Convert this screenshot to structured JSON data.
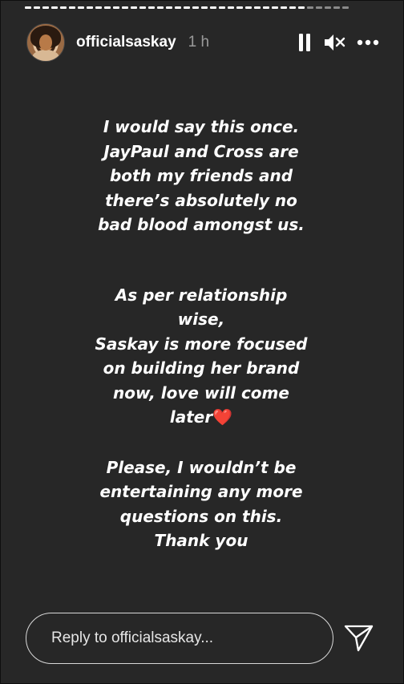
{
  "header": {
    "username": "officialsaskay",
    "time": "1 h",
    "controls": [
      "pause-icon",
      "mute-icon",
      "more-icon"
    ]
  },
  "progress": {
    "segments_total": 37,
    "segments_viewed": 32,
    "viewed_color": "#ffffff",
    "remaining_color": "#8a8a8a"
  },
  "story": {
    "background": "#272727",
    "paragraphs": [
      [
        "I would say this once.",
        "JayPaul and Cross are",
        "both my friends and",
        "there’s absolutely no",
        "bad blood amongst us."
      ],
      [
        "As per relationship",
        "wise,",
        "Saskay is more focused",
        "on building her brand",
        "now, love will come",
        "later"
      ],
      [
        "Please, I wouldn’t be",
        "entertaining any more",
        "questions on this.",
        "Thank you"
      ]
    ],
    "heart": "❤️"
  },
  "reply": {
    "placeholder": "Reply to officialsaskay..."
  }
}
